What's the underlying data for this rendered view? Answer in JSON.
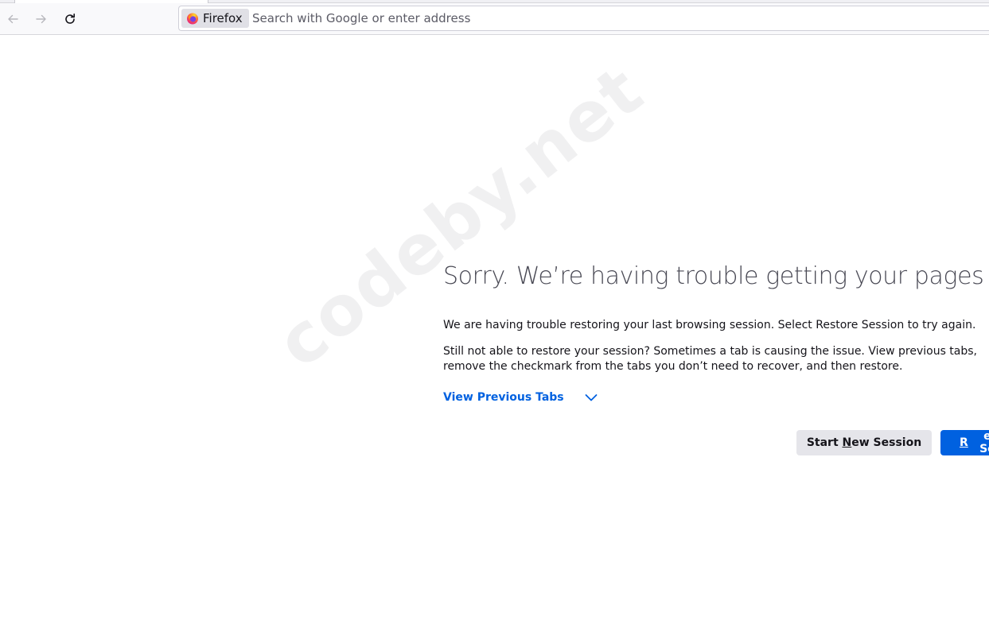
{
  "toolbar": {
    "back_icon": "arrow-left-icon",
    "forward_icon": "arrow-right-icon",
    "reload_icon": "reload-icon",
    "identity_label": "Firefox",
    "identity_icon": "firefox-logo-icon",
    "url_placeholder": "Search with Google or enter address"
  },
  "session_restore": {
    "title": "Sorry. We’re having trouble getting your pages back.",
    "message": "We are having trouble restoring your last browsing session. Select Restore Session to try again.",
    "help_text": "Still not able to restore your session? Sometimes a tab is causing the issue. View previous tabs, remove the checkmark from the tabs you don’t need to recover, and then restore.",
    "view_tabs_label": "View Previous Tabs",
    "view_tabs_icon": "chevron-down-icon",
    "start_new_session": {
      "before": "Start ",
      "accesskey": "N",
      "after": "ew Session"
    },
    "restore_session": {
      "accesskey": "R",
      "after": "estore Session"
    }
  },
  "watermark": "codeby.net",
  "colors": {
    "accent": "#0061e0",
    "toolbar_bg": "#f9f9fb",
    "secondary_button_bg": "#e5e5ea",
    "text": "#15141a"
  }
}
